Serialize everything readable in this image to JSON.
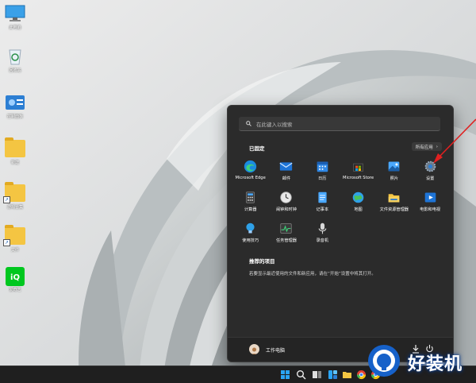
{
  "desktop": {
    "icons": [
      {
        "label": "此电脑",
        "icon": "monitor-icon"
      },
      {
        "label": "回收站",
        "icon": "recycle-bin-icon"
      },
      {
        "label": "控制面板",
        "icon": "control-panel-icon"
      },
      {
        "label": "新建",
        "icon": "folder-icon"
      },
      {
        "label": "游戏合集",
        "icon": "folder-icon"
      },
      {
        "label": "文件",
        "icon": "folder-icon"
      },
      {
        "label": "爱奇艺",
        "icon": "iqiyi-icon"
      }
    ]
  },
  "start_menu": {
    "search_placeholder": "在此键入以搜索",
    "pinned_title": "已固定",
    "all_apps_label": "所有应用",
    "pinned_apps": [
      {
        "label": "Microsoft Edge",
        "icon": "edge-icon"
      },
      {
        "label": "邮件",
        "icon": "mail-icon"
      },
      {
        "label": "日历",
        "icon": "calendar-icon"
      },
      {
        "label": "Microsoft Store",
        "icon": "store-icon"
      },
      {
        "label": "照片",
        "icon": "photos-icon"
      },
      {
        "label": "设置",
        "icon": "settings-icon"
      },
      {
        "label": "计算器",
        "icon": "calculator-icon"
      },
      {
        "label": "闹钟和时钟",
        "icon": "clock-icon"
      },
      {
        "label": "记事本",
        "icon": "notepad-icon"
      },
      {
        "label": "地图",
        "icon": "maps-icon"
      },
      {
        "label": "文件资源管理器",
        "icon": "file-explorer-icon"
      },
      {
        "label": "电影和电视",
        "icon": "movies-icon"
      },
      {
        "label": "使用技巧",
        "icon": "tips-icon"
      },
      {
        "label": "任务管理器",
        "icon": "task-manager-icon"
      },
      {
        "label": "录音机",
        "icon": "recorder-icon"
      }
    ],
    "recommended_title": "推荐的项目",
    "recommended_text": "若要显示最近使用的文件和新应用，请在“开始”设置中将其打开。",
    "user_name": "工作电脑"
  },
  "taskbar": {
    "items": [
      "start-icon",
      "search-icon",
      "task-view-icon",
      "widgets-icon",
      "file-explorer-icon",
      "chrome-icon",
      "chrome-icon",
      "edge-icon",
      "folder-icon"
    ]
  },
  "watermark": {
    "text": "好装机"
  },
  "colors": {
    "accent": "#0078d4",
    "menu_bg": "#2b2b2b",
    "taskbar_bg": "#1f1f1f",
    "arrow": "#e02020"
  }
}
